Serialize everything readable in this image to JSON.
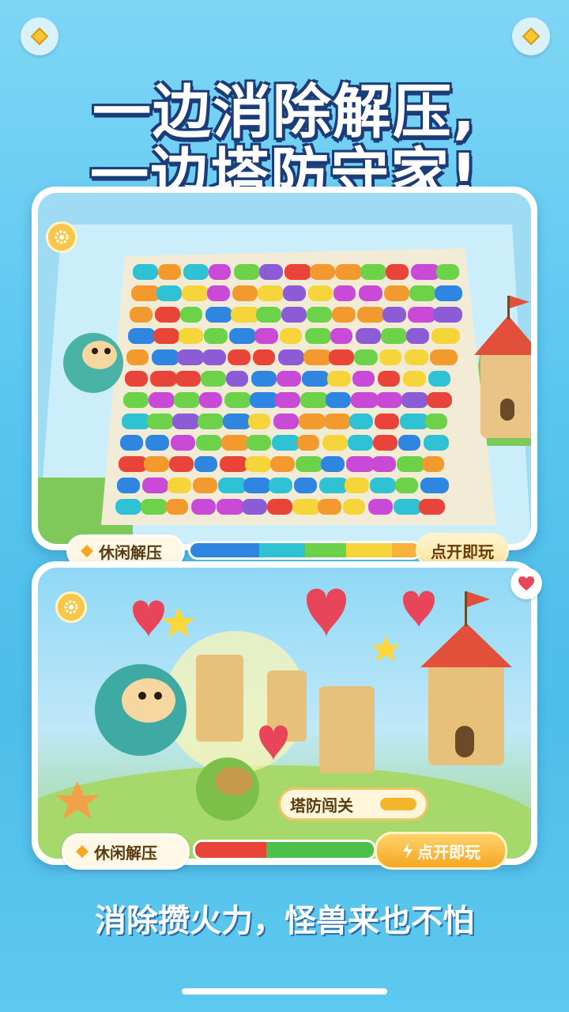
{
  "header": {
    "left_button_icon": "gem-icon",
    "right_button_icon": "gem-icon",
    "headline_line1": "一边消除解压,",
    "headline_line2": "一边塔防守家!"
  },
  "card_puzzle": {
    "settings_icon": "gear-icon",
    "tag_label": "休闲解压",
    "play_label": "点开即玩",
    "bar_colors": [
      "#2f86e0",
      "#2fc2d4",
      "#6cd24a",
      "#f6d53a",
      "#f7b23a"
    ]
  },
  "card_defense": {
    "settings_icon": "gear-icon",
    "heart_icon": "heart-icon",
    "stage_label": "塔防闯关",
    "tag_label": "休闲解压",
    "play_label": "点开即玩",
    "bar_colors": [
      "#e8443a",
      "#4cc04a"
    ]
  },
  "footer": {
    "tagline": "消除攒火力，怪兽来也不怕"
  }
}
